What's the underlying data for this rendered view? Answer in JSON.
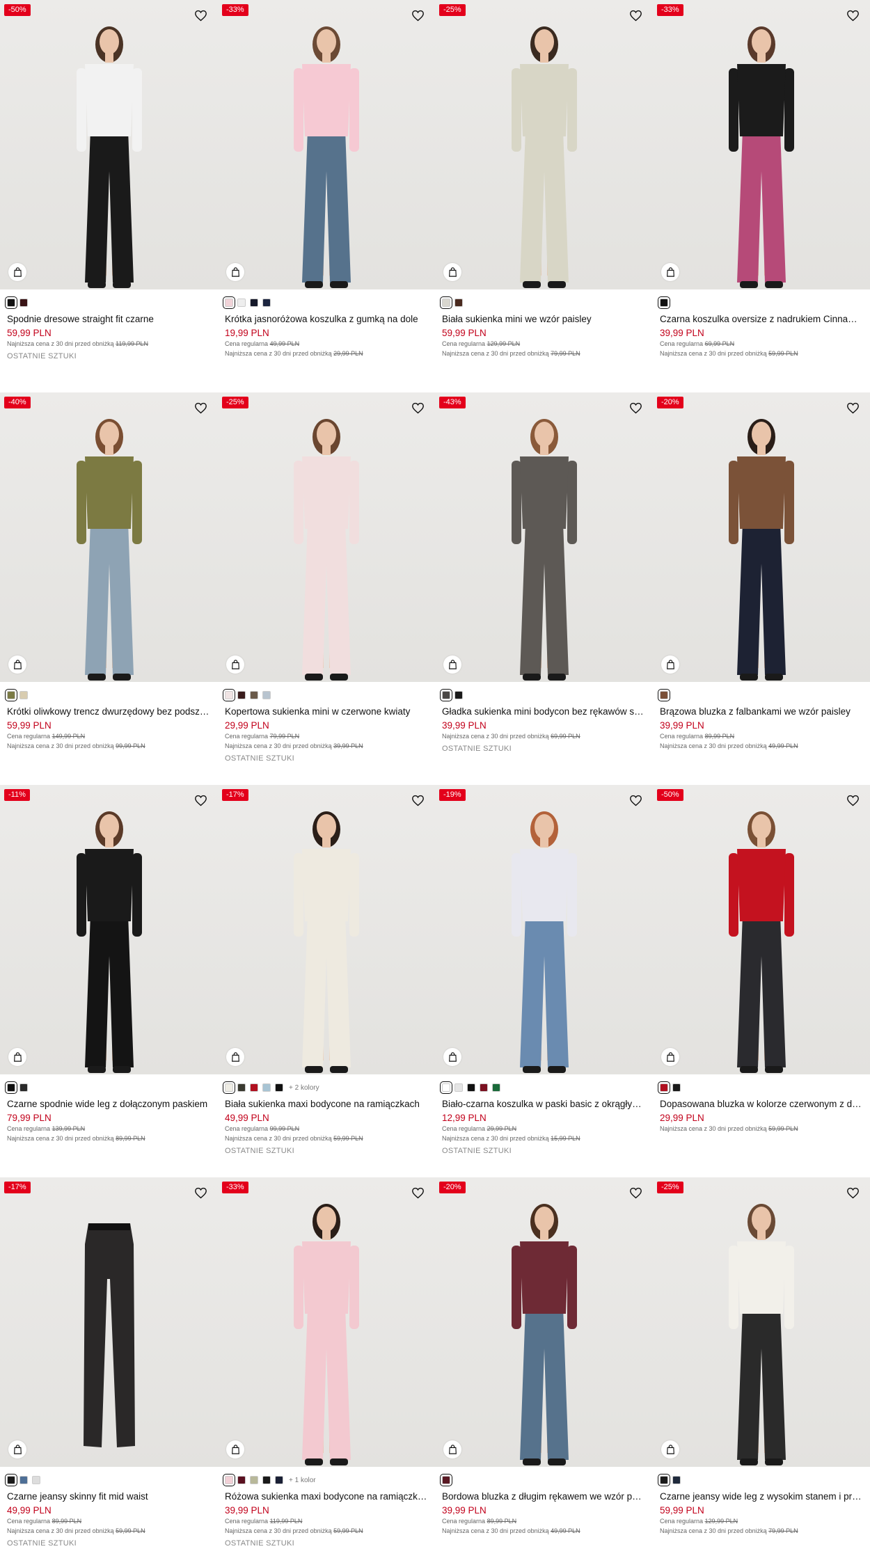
{
  "labels": {
    "regular": "Cena regularna",
    "lowest": "Najniższa cena z 30 dni przed obniżką",
    "last_pieces": "OSTATNIE SZTUKI"
  },
  "products": [
    {
      "badge": "-50%",
      "name": "Spodnie dresowe straight fit czarne",
      "price": "59,99 PLN",
      "regular": "",
      "lowest": "119,99 PLN",
      "last": true,
      "swatches": [
        "#111111",
        "#3a1416"
      ],
      "more": "",
      "top": "#f2f2f2",
      "bottom": "#1a1a1a",
      "hair": "#4a3325"
    },
    {
      "badge": "-33%",
      "name": "Krótka jasnoróżowa koszulka z gumką na dole",
      "price": "19,99 PLN",
      "regular": "49,99 PLN",
      "lowest": "29,99 PLN",
      "last": false,
      "swatches": [
        "#f1d3d8",
        "#eeeeee",
        "#15192a",
        "#1c2540"
      ],
      "more": "",
      "top": "#f6c9d3",
      "bottom": "#56728c",
      "hair": "#6b4a35"
    },
    {
      "badge": "-25%",
      "name": "Biała sukienka mini we wzór paisley",
      "price": "59,99 PLN",
      "regular": "129,99 PLN",
      "lowest": "79,99 PLN",
      "last": false,
      "swatches": [
        "#d9d7cf",
        "#4a2a1f"
      ],
      "more": "",
      "top": "#d8d6c6",
      "bottom": "#d8d6c6",
      "hair": "#3a2a20"
    },
    {
      "badge": "-33%",
      "name": "Czarna koszulka oversize z nadrukiem Cinnamoroll",
      "price": "39,99 PLN",
      "regular": "69,99 PLN",
      "lowest": "59,99 PLN",
      "last": false,
      "swatches": [
        "#111111"
      ],
      "more": "",
      "top": "#1b1b1b",
      "bottom": "#b64a78",
      "hair": "#5a3a2b"
    },
    {
      "badge": "-40%",
      "name": "Krótki oliwkowy trencz dwurzędowy bez podszewki",
      "price": "59,99 PLN",
      "regular": "149,99 PLN",
      "lowest": "99,99 PLN",
      "last": false,
      "swatches": [
        "#7a7a45",
        "#d8ccb0"
      ],
      "more": "",
      "top": "#7c7a42",
      "bottom": "#8ea3b4",
      "hair": "#7a4e32"
    },
    {
      "badge": "-25%",
      "name": "Kopertowa sukienka mini w czerwone kwiaty",
      "price": "29,99 PLN",
      "regular": "79,99 PLN",
      "lowest": "39,99 PLN",
      "last": true,
      "swatches": [
        "#f0e4e4",
        "#3a1c1c",
        "#6a5a4a",
        "#b8c4cf"
      ],
      "more": "",
      "top": "#f1dede",
      "bottom": "#f1dede",
      "hair": "#6a4630"
    },
    {
      "badge": "-43%",
      "name": "Gładka sukienka mini bodycon bez rękawów szara",
      "price": "39,99 PLN",
      "regular": "",
      "lowest": "69,99 PLN",
      "last": true,
      "swatches": [
        "#4a4745",
        "#1a1a1a"
      ],
      "more": "",
      "top": "#5d5955",
      "bottom": "#5d5955",
      "hair": "#8a5a3a"
    },
    {
      "badge": "-20%",
      "name": "Brązowa bluzka z falbankami we wzór paisley",
      "price": "39,99 PLN",
      "regular": "89,99 PLN",
      "lowest": "49,99 PLN",
      "last": false,
      "swatches": [
        "#7a5038"
      ],
      "more": "",
      "top": "#7b5238",
      "bottom": "#1d2233",
      "hair": "#2a1e18"
    },
    {
      "badge": "-11%",
      "name": "Czarne spodnie wide leg z dołączonym paskiem",
      "price": "79,99 PLN",
      "regular": "139,99 PLN",
      "lowest": "89,99 PLN",
      "last": false,
      "swatches": [
        "#111111",
        "#2a2a2a"
      ],
      "more": "",
      "top": "#1a1a1a",
      "bottom": "#141414",
      "hair": "#5a3a28"
    },
    {
      "badge": "-17%",
      "name": "Biała sukienka maxi bodycone na ramiączkach",
      "price": "49,99 PLN",
      "regular": "99,99 PLN",
      "lowest": "59,99 PLN",
      "last": true,
      "swatches": [
        "#eeece4",
        "#3a3a30",
        "#b01020",
        "#a8c4d4",
        "#111111"
      ],
      "more": "+ 2 kolory",
      "top": "#eeeae0",
      "bottom": "#eeeae0",
      "hair": "#2a1e18"
    },
    {
      "badge": "-19%",
      "name": "Biało-czarna koszulka w paski basic z okrągłym dekoltem",
      "price": "12,99 PLN",
      "regular": "29,99 PLN",
      "lowest": "15,99 PLN",
      "last": true,
      "swatches": [
        "#ffffff",
        "#e5e5e5",
        "#111111",
        "#7a1020",
        "#1a6a3a"
      ],
      "more": "",
      "top": "#e8e8ef",
      "bottom": "#6a8bb0",
      "hair": "#b3623a"
    },
    {
      "badge": "-50%",
      "name": "Dopasowana bluzka w kolorze czerwonym z długim rękawem",
      "price": "29,99 PLN",
      "regular": "",
      "lowest": "59,99 PLN",
      "last": false,
      "swatches": [
        "#b01020",
        "#1a1a1a"
      ],
      "more": "",
      "top": "#c4121f",
      "bottom": "#2a2a2e",
      "hair": "#7a5035"
    },
    {
      "badge": "-17%",
      "name": "Czarne jeansy skinny fit mid waist",
      "price": "49,99 PLN",
      "regular": "89,99 PLN",
      "lowest": "59,99 PLN",
      "last": true,
      "swatches": [
        "#1a1a1a",
        "#4e6f96",
        "#dddddd"
      ],
      "more": "",
      "top": "",
      "bottom": "#2a2828",
      "hair": ""
    },
    {
      "badge": "-33%",
      "name": "Różowa sukienka maxi bodycone na ramiączkach",
      "price": "39,99 PLN",
      "regular": "119,99 PLN",
      "lowest": "59,99 PLN",
      "last": true,
      "swatches": [
        "#f2d0d6",
        "#5a1020",
        "#b8b89a",
        "#1a1a1a",
        "#1a2035"
      ],
      "more": "+ 1 kolor",
      "top": "#f3c9d0",
      "bottom": "#f3c9d0",
      "hair": "#2a1e18"
    },
    {
      "badge": "-20%",
      "name": "Bordowa bluzka z długim rękawem we wzór paisley",
      "price": "39,99 PLN",
      "regular": "89,99 PLN",
      "lowest": "49,99 PLN",
      "last": false,
      "swatches": [
        "#5a1a24"
      ],
      "more": "",
      "top": "#6e2a35",
      "bottom": "#56728c",
      "hair": "#4a3020"
    },
    {
      "badge": "-25%",
      "name": "Czarne jeansy wide leg z wysokim stanem i przetarciami",
      "price": "59,99 PLN",
      "regular": "129,99 PLN",
      "lowest": "79,99 PLN",
      "last": false,
      "swatches": [
        "#1a1a1a",
        "#1f2a3c"
      ],
      "more": "",
      "top": "#f2f0ea",
      "bottom": "#2a2a2a",
      "hair": "#6a4a35"
    }
  ]
}
